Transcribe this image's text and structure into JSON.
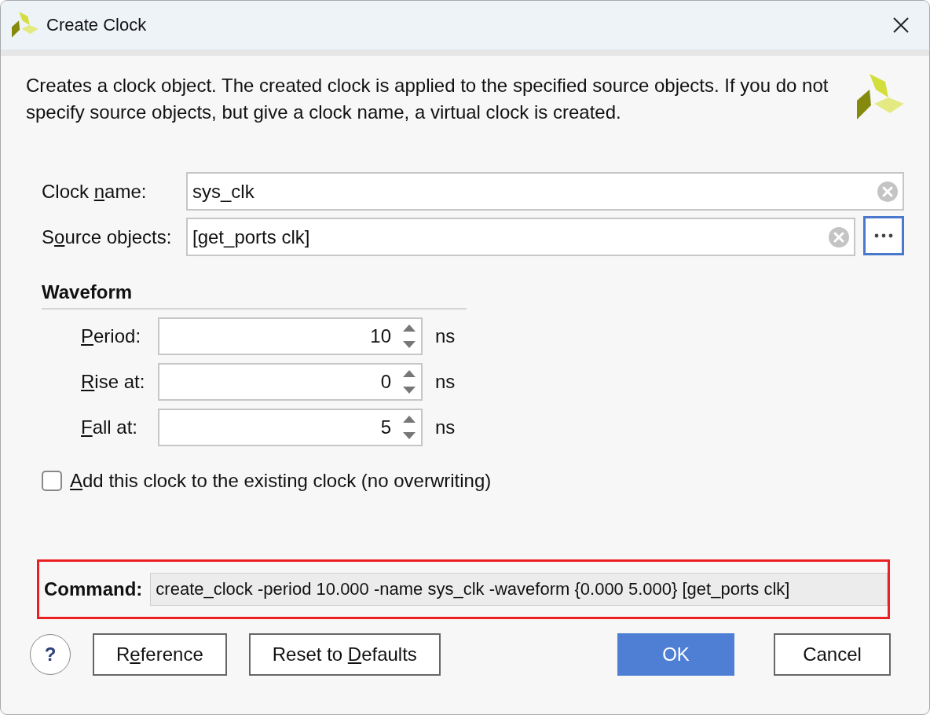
{
  "window": {
    "title": "Create Clock"
  },
  "description": "Creates a clock object. The created clock is applied to the specified source objects. If you do not specify source objects, but give a clock name, a virtual clock is created.",
  "fields": [
    {
      "label": {
        "before": "Clock ",
        "key": "n",
        "after": "ame:"
      },
      "value": "sys_clk",
      "browse": false
    },
    {
      "label": {
        "before": "S",
        "key": "o",
        "after": "urce objects:"
      },
      "value": "[get_ports clk]",
      "browse": true
    }
  ],
  "waveform": {
    "title": "Waveform",
    "rows": [
      {
        "label": {
          "key": "P",
          "after": "eriod:"
        },
        "value": "10",
        "unit": "ns"
      },
      {
        "label": {
          "key": "R",
          "after": "ise at:"
        },
        "value": "0",
        "unit": "ns"
      },
      {
        "label": {
          "key": "F",
          "after": "all at:"
        },
        "value": "5",
        "unit": "ns"
      }
    ]
  },
  "checkbox": {
    "label": {
      "key": "A",
      "after": "dd this clock to the existing clock (no overwriting)"
    },
    "checked": false
  },
  "command": {
    "label": "Command:",
    "value": "create_clock -period 10.000 -name sys_clk -waveform {0.000 5.000} [get_ports clk]",
    "highlighted": true
  },
  "buttons_left": [
    {
      "kind": "help",
      "label": "?"
    },
    {
      "kind": "plain",
      "label": {
        "before": "R",
        "key": "e",
        "after": "ference"
      }
    },
    {
      "kind": "plain",
      "label": {
        "before": "Reset to ",
        "key": "D",
        "after": "efaults"
      }
    }
  ],
  "buttons_right": [
    {
      "kind": "primary",
      "label": "OK"
    },
    {
      "kind": "plain",
      "label": "Cancel"
    }
  ]
}
